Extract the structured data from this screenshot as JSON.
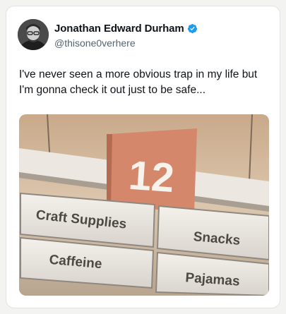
{
  "tweet": {
    "author_name": "Jonathan Edward Durham",
    "author_handle": "@thisone0verhere",
    "verified_color": "#1d9bf0",
    "text": "I've never seen a more obvious trap in my life but I'm gonna check it out just to be safe..."
  },
  "photo": {
    "aisle_number": "12",
    "signs": {
      "top_left": "Craft Supplies",
      "top_right": "Snacks",
      "bottom_left": "Caffeine",
      "bottom_right": "Pajamas"
    }
  }
}
